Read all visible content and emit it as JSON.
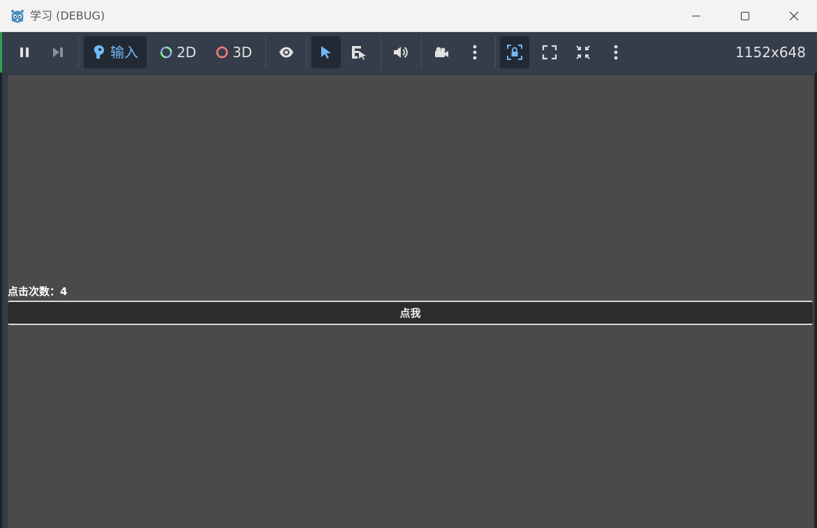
{
  "window": {
    "title": "学习 (DEBUG)",
    "app_icon": "godot-icon",
    "controls": [
      "minimize-icon",
      "maximize-icon",
      "close-icon"
    ]
  },
  "toolbar": {
    "pause_icon": "pause-icon",
    "next_frame_icon": "next-frame-icon",
    "input_label": "输入",
    "input_icon": "input-icon",
    "mode_2d_label": "2D",
    "mode_3d_label": "3D",
    "mode_2d_color": "#8da5f3",
    "mode_3d_color": "#fc7f7f",
    "visibility_icon": "eye-icon",
    "select_icon": "cursor-arrow-icon",
    "list_select_icon": "list-select-icon",
    "audio_icon": "speaker-icon",
    "camera_icon": "camera-icon",
    "more_icon": "more-vertical-icon",
    "lock_icon": "lock-camera-icon",
    "fullscreen_icon": "expand-icon",
    "shrink_icon": "shrink-icon",
    "more2_icon": "more-vertical-icon",
    "resolution": "1152x648",
    "accent": "#70b9f5"
  },
  "game": {
    "click_count_label": "点击次数：4",
    "button_label": "点我"
  }
}
